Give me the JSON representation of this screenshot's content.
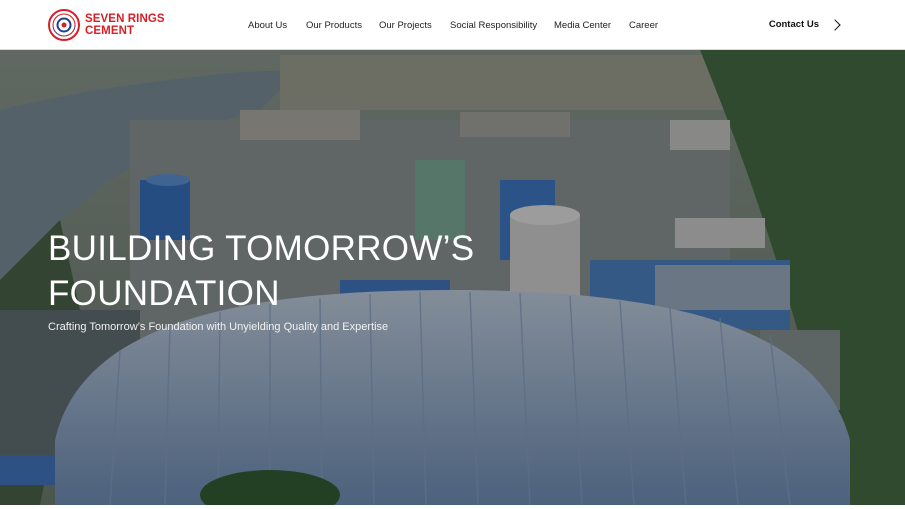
{
  "brand": {
    "name_line1": "SEVEN RINGS",
    "name_line2": "CEMENT",
    "color": "#d71f26"
  },
  "nav": {
    "items": [
      {
        "label": "About Us"
      },
      {
        "label": "Our Products"
      },
      {
        "label": "Our Projects"
      },
      {
        "label": "Social Responsibility"
      },
      {
        "label": "Media Center"
      },
      {
        "label": "Career"
      }
    ],
    "contact_label": "Contact Us",
    "contact_icon": "chevron-right-icon"
  },
  "hero": {
    "title_line1": "BUILDING TOMORROW’S",
    "title_line2": "FOUNDATION",
    "subtitle": "Crafting Tomorrow’s Foundation with Unyielding Quality and Expertise"
  }
}
